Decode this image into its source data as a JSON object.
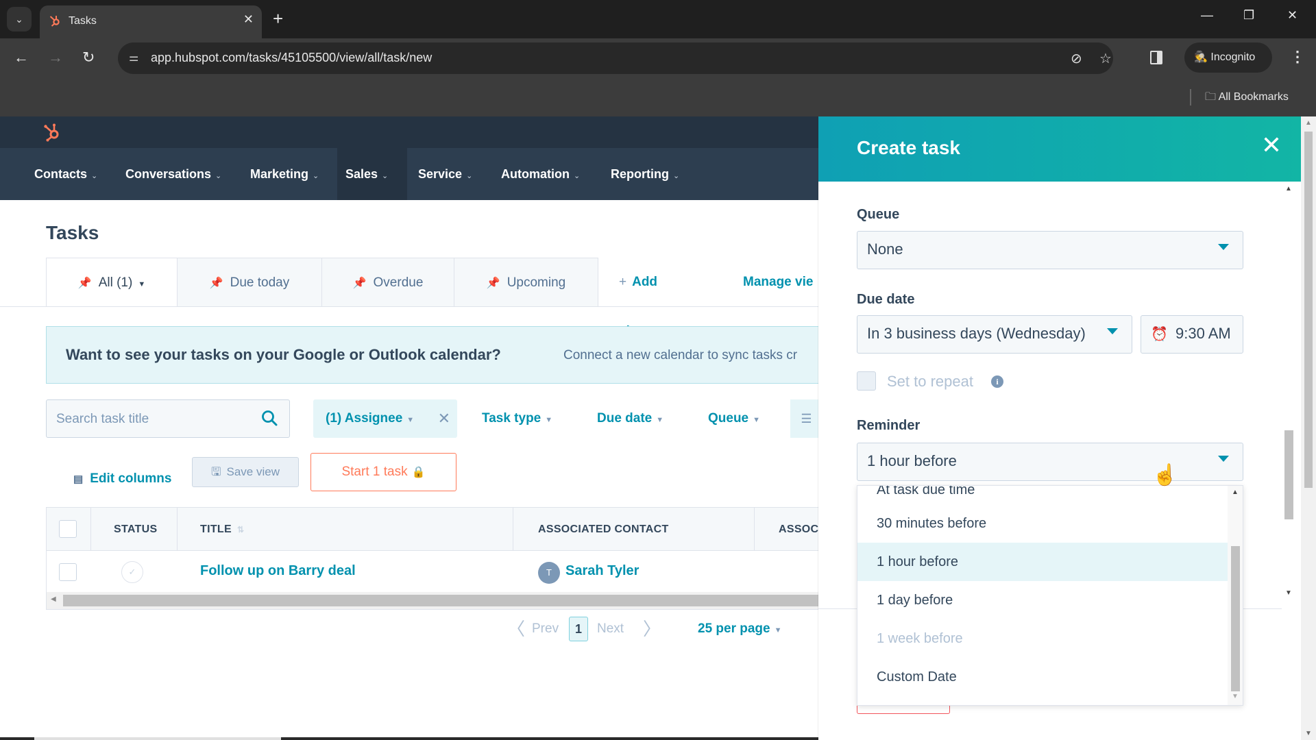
{
  "browser": {
    "tab_title": "Tasks",
    "url": "app.hubspot.com/tasks/45105500/view/all/task/new",
    "profile_label": "Incognito",
    "bookmarks_label": "All Bookmarks"
  },
  "colors": {
    "brand": "#ff7a59",
    "accent": "#0091ae",
    "header_gradient_start": "#0fa0b4",
    "header_gradient_end": "#12b5a5",
    "nav_background": "#2d3e50"
  },
  "nav": {
    "items": [
      {
        "label": "Contacts"
      },
      {
        "label": "Conversations"
      },
      {
        "label": "Marketing"
      },
      {
        "label": "Sales"
      },
      {
        "label": "Service"
      },
      {
        "label": "Automation"
      },
      {
        "label": "Reporting"
      }
    ],
    "active": "Sales"
  },
  "page": {
    "title": "Tasks",
    "views": [
      {
        "label": "All (1)",
        "active": true
      },
      {
        "label": "Due today"
      },
      {
        "label": "Overdue"
      },
      {
        "label": "Upcoming"
      }
    ],
    "add_view": "Add view",
    "manage_views": "Manage vie"
  },
  "banner": {
    "question": "Want to see your tasks on your Google or Outlook calendar?",
    "description": "Connect a new calendar to sync tasks cr"
  },
  "filters": {
    "search_placeholder": "Search task title",
    "search_value": "",
    "assignee": "(1) Assignee",
    "task_type": "Task type",
    "due_date": "Due date",
    "queue": "Queue"
  },
  "actions": {
    "edit_columns": "Edit columns",
    "save_view": "Save view",
    "start_tasks": "Start 1 task"
  },
  "table": {
    "columns": [
      "STATUS",
      "TITLE",
      "ASSOCIATED CONTACT",
      "ASSOC"
    ],
    "rows": [
      {
        "title": "Follow up on Barry deal",
        "contact_initial": "T",
        "contact": "Sarah Tyler"
      }
    ]
  },
  "pagination": {
    "prev": "Prev",
    "current_page": "1",
    "next": "Next",
    "per_page": "25 per page"
  },
  "panel": {
    "title": "Create task",
    "queue_label": "Queue",
    "queue_value": "None",
    "due_date_label": "Due date",
    "due_date_value": "In 3 business days (Wednesday)",
    "due_time_value": "9:30 AM",
    "repeat_label": "Set to repeat",
    "reminder_label": "Reminder",
    "reminder_value": "1 hour before",
    "reminder_options": [
      {
        "label": "At task due time",
        "state": "partially-visible"
      },
      {
        "label": "30 minutes before",
        "state": "normal"
      },
      {
        "label": "1 hour before",
        "state": "selected"
      },
      {
        "label": "1 day before",
        "state": "normal"
      },
      {
        "label": "1 week before",
        "state": "disabled"
      },
      {
        "label": "Custom Date",
        "state": "normal"
      }
    ]
  }
}
